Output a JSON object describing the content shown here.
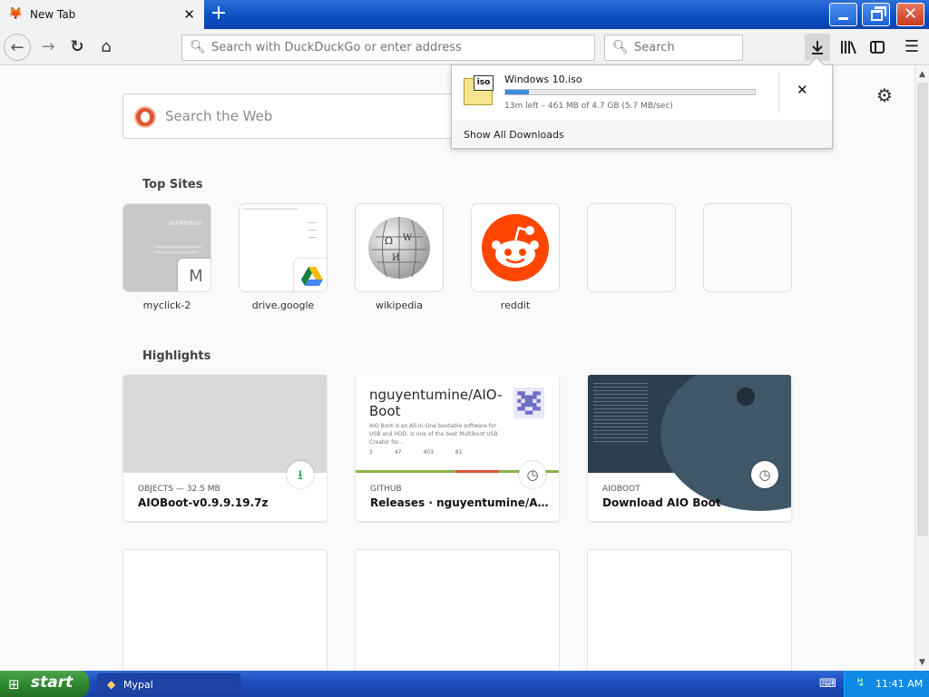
{
  "tab": {
    "title": "New Tab",
    "favicon": "firefox-icon",
    "close": "✕",
    "new_tab": "+"
  },
  "address_bar": {
    "placeholder": "Search with DuckDuckGo or enter address"
  },
  "search_bar": {
    "placeholder": "Search"
  },
  "new_tab_page": {
    "web_search_placeholder": "Search the Web",
    "top_sites_title": "Top Sites",
    "top_sites": [
      {
        "label": "myclick-2",
        "badge": "M",
        "thumb_text": "WARNING!"
      },
      {
        "label": "drive.google"
      },
      {
        "label": "wikipedia"
      },
      {
        "label": "reddit"
      },
      {
        "label": ""
      },
      {
        "label": ""
      }
    ],
    "highlights_title": "Highlights",
    "highlights": [
      {
        "context": "OBJECTS — 32.5 MB",
        "title": "AIOBoot-v0.9.9.19.7z",
        "badge": "download-icon"
      },
      {
        "context": "GITHUB",
        "title": "Releases · nguyentumine/AIO-B...",
        "badge": "clock-icon",
        "preview_title": "nguyentumine/AIO-Boot",
        "preview_desc": "AIO Boot is an All-in-One bootable software for USB and HDD. Is one of the best Multiboot USB Creator for...",
        "preview_stats": [
          "3",
          "47",
          "403",
          "81"
        ]
      },
      {
        "context": "AIOBOOT",
        "title": "Download AIO Boot",
        "badge": "clock-icon"
      }
    ]
  },
  "downloads_panel": {
    "file_name": "Windows 10.iso",
    "icon_label": "iso",
    "progress": 0.095,
    "status": "13m left – 461 MB of 4.7 GB (5.7 MB/sec)",
    "cancel": "✕",
    "show_all": "Show All Downloads"
  },
  "taskbar": {
    "start_label": "start",
    "app_label": "Mypal",
    "clock": "11:41 AM"
  },
  "colors": {
    "accent_blue": "#0a4ec4",
    "progress_fill": "#3d8de0",
    "reddit": "#ff4500",
    "duckduckgo": "#de5833",
    "start_green": "#2f8a2f"
  }
}
